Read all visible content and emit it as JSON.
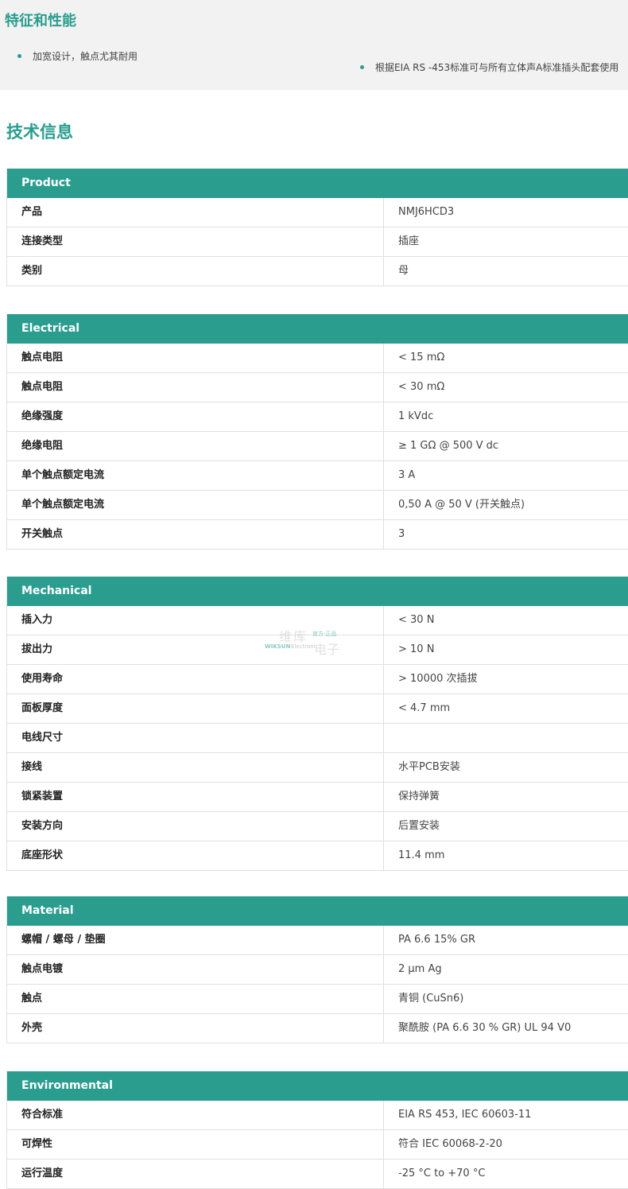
{
  "features": {
    "title": "特征和性能",
    "items": [
      "加宽设计，触点尤其耐用",
      "根据EIA RS -453标准可与所有立体声A标准插头配套使用"
    ]
  },
  "tech_title": "技术信息",
  "sections": [
    {
      "header": "Product",
      "rows": [
        {
          "label": "产品",
          "value": "NMJ6HCD3"
        },
        {
          "label": "连接类型",
          "value": "插座"
        },
        {
          "label": "类别",
          "value": "母"
        }
      ]
    },
    {
      "header": "Electrical",
      "rows": [
        {
          "label": "触点电阻",
          "value": "< 15 mΩ"
        },
        {
          "label": "触点电阻",
          "value": "< 30 mΩ"
        },
        {
          "label": "绝缘强度",
          "value": "1 kVdc"
        },
        {
          "label": "绝缘电阻",
          "value": "≥ 1 GΩ @ 500 V dc"
        },
        {
          "label": "单个触点额定电流",
          "value": "3 A"
        },
        {
          "label": "单个触点额定电流",
          "value": "0,50 A @ 50 V (开关触点)"
        },
        {
          "label": "开关触点",
          "value": "3"
        }
      ]
    },
    {
      "header": "Mechanical",
      "rows": [
        {
          "label": "插入力",
          "value": "< 30 N"
        },
        {
          "label": "拔出力",
          "value": "> 10 N"
        },
        {
          "label": "使用寿命",
          "value": "> 10000 次插拔"
        },
        {
          "label": "面板厚度",
          "value": "< 4.7 mm"
        },
        {
          "label": "电线尺寸",
          "value": ""
        },
        {
          "label": "接线",
          "value": "水平PCB安装"
        },
        {
          "label": "锁紧装置",
          "value": "保持弹簧"
        },
        {
          "label": "安装方向",
          "value": "后置安装"
        },
        {
          "label": "底座形状",
          "value": "11.4 mm"
        }
      ]
    },
    {
      "header": "Material",
      "rows": [
        {
          "label": "螺帽 / 螺母 / 垫圈",
          "value": "PA 6.6 15% GR"
        },
        {
          "label": "触点电镀",
          "value": "2 µm Ag"
        },
        {
          "label": "触点",
          "value": "青铜 (CuSn6)"
        },
        {
          "label": "外壳",
          "value": "聚酰胺 (PA 6.6 30 % GR) UL 94 V0"
        }
      ]
    },
    {
      "header": "Environmental",
      "rows": [
        {
          "label": "符合标准",
          "value": "EIA RS 453, IEC 60603-11"
        },
        {
          "label": "可焊性",
          "value": "符合 IEC 60068-2-20"
        },
        {
          "label": "运行温度",
          "value": "-25 °C to +70 °C"
        }
      ]
    }
  ],
  "watermark": {
    "cn_top": "维库",
    "tag": "官方·正品",
    "en": "WIKSUN",
    "en2": "Electronic",
    "cn_bottom": "电子"
  }
}
